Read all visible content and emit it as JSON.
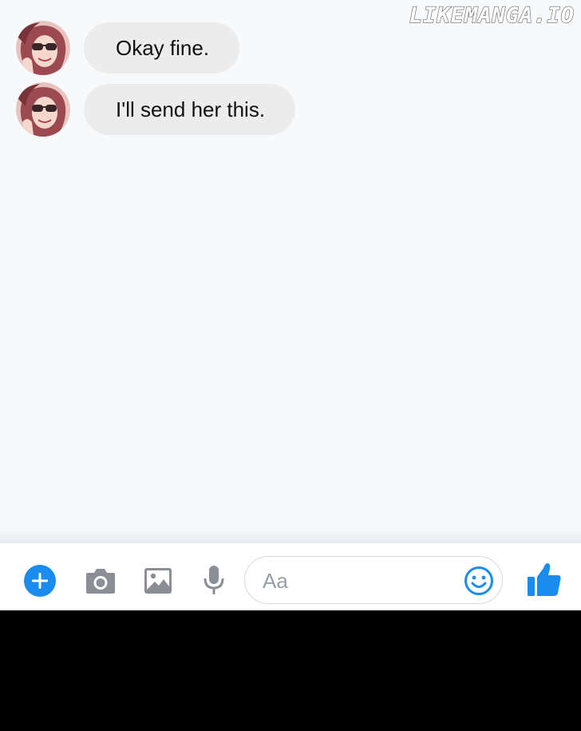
{
  "watermark": "LIKEMANGA.IO",
  "messages": [
    {
      "text": "Okay fine."
    },
    {
      "text": "I'll send her this."
    }
  ],
  "composer": {
    "placeholder": "Aa"
  },
  "icons": {
    "add": "plus-circle-icon",
    "camera": "camera-icon",
    "gallery": "image-icon",
    "voice": "microphone-icon",
    "emoji": "smiley-icon",
    "like": "thumbs-up-icon"
  },
  "colors": {
    "accent": "#1a8cf0",
    "bubble": "#ececec",
    "chat_background": "#f8f9fb",
    "tool_gray": "#8b8f95"
  }
}
